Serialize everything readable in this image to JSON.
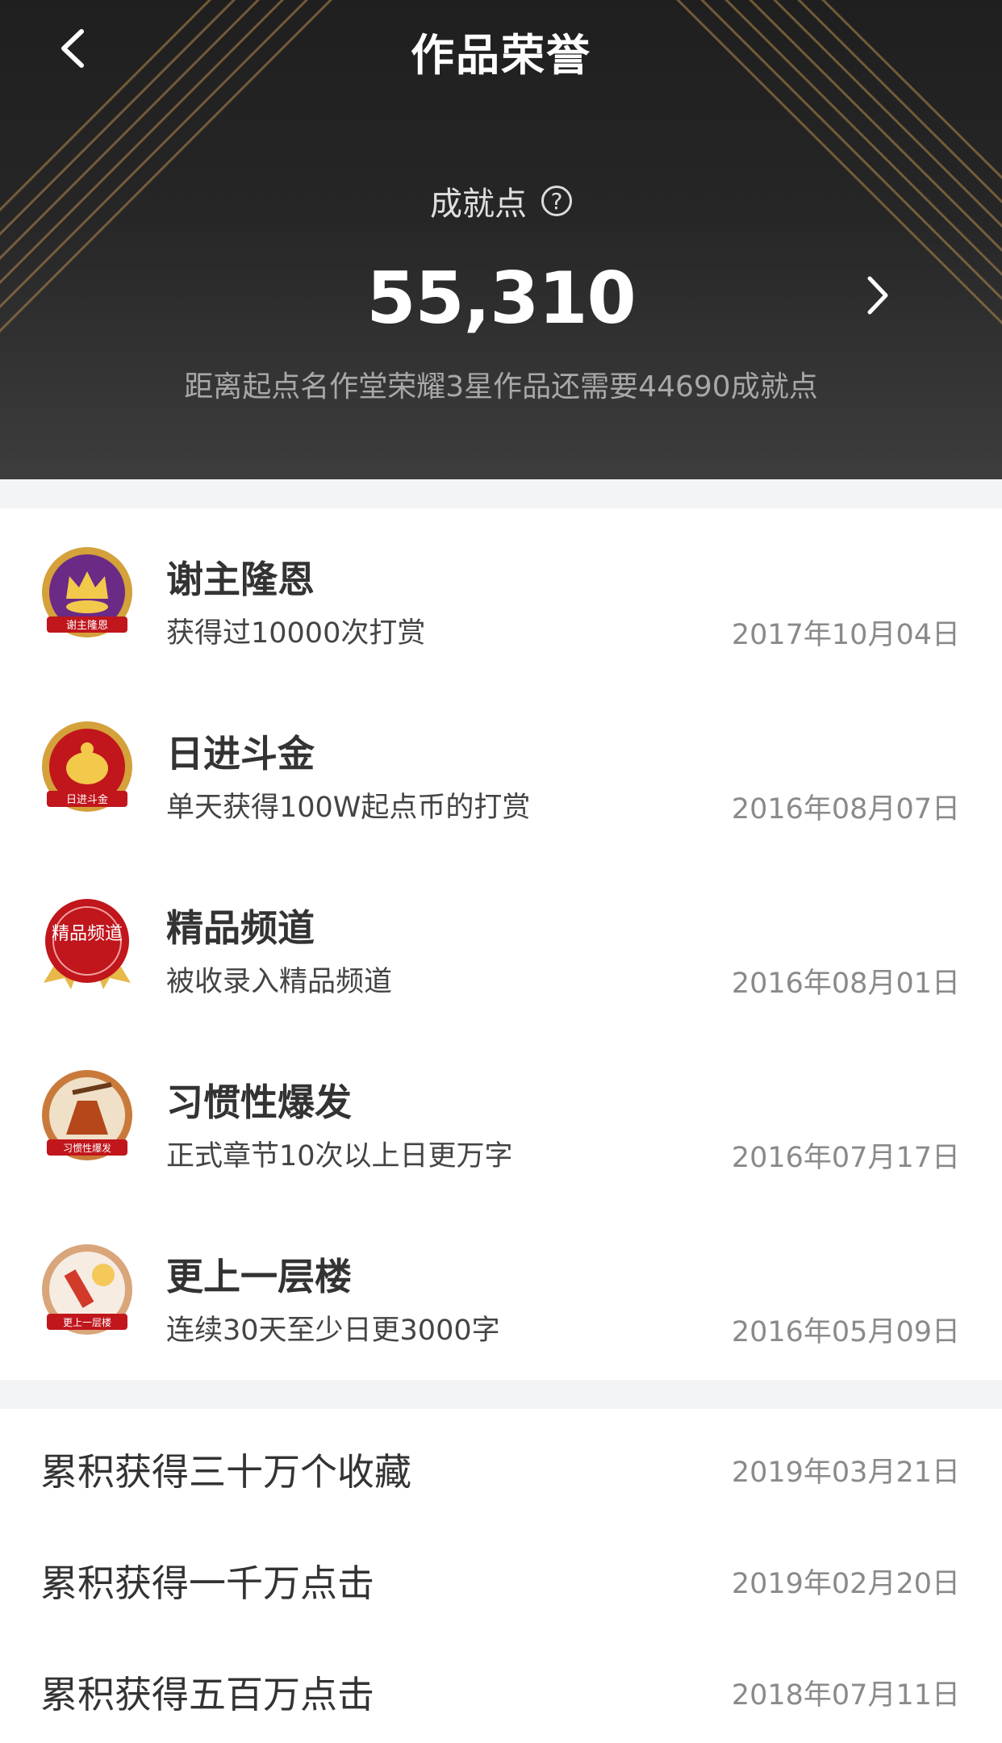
{
  "header": {
    "title": "作品荣誉",
    "score_label": "成就点",
    "score_value": "55,310",
    "score_note": "距离起点名作堂荣耀3星作品还需要44690成就点"
  },
  "icons": {
    "back": "chevron-left-icon",
    "help": "question-circle-icon",
    "forward": "chevron-right-icon"
  },
  "honors": [
    {
      "title": "谢主隆恩",
      "desc": "获得过10000次打赏",
      "date": "2017年10月04日",
      "badge_text": "谢主隆恩",
      "badge_color": "#6a2a86"
    },
    {
      "title": "日进斗金",
      "desc": "单天获得100W起点币的打赏",
      "date": "2016年08月07日",
      "badge_text": "日进斗金",
      "badge_color": "#c0161c"
    },
    {
      "title": "精品频道",
      "desc": "被收录入精品频道",
      "date": "2016年08月01日",
      "badge_text": "精品频道",
      "badge_color": "#c0161c"
    },
    {
      "title": "习惯性爆发",
      "desc": "正式章节10次以上日更万字",
      "date": "2016年07月17日",
      "badge_text": "习惯性爆发",
      "badge_color": "#b5471a"
    },
    {
      "title": "更上一层楼",
      "desc": "连续30天至少日更3000字",
      "date": "2016年05月09日",
      "badge_text": "更上一层楼",
      "badge_color": "#e8d2bc"
    }
  ],
  "milestones": [
    {
      "title": "累积获得三十万个收藏",
      "date": "2019年03月21日"
    },
    {
      "title": "累积获得一千万点击",
      "date": "2019年02月20日"
    },
    {
      "title": "累积获得五百万点击",
      "date": "2018年07月11日"
    }
  ],
  "colors": {
    "header_bg": "#262626",
    "gold": "#c9a46a",
    "divider": "#f3f4f6"
  }
}
